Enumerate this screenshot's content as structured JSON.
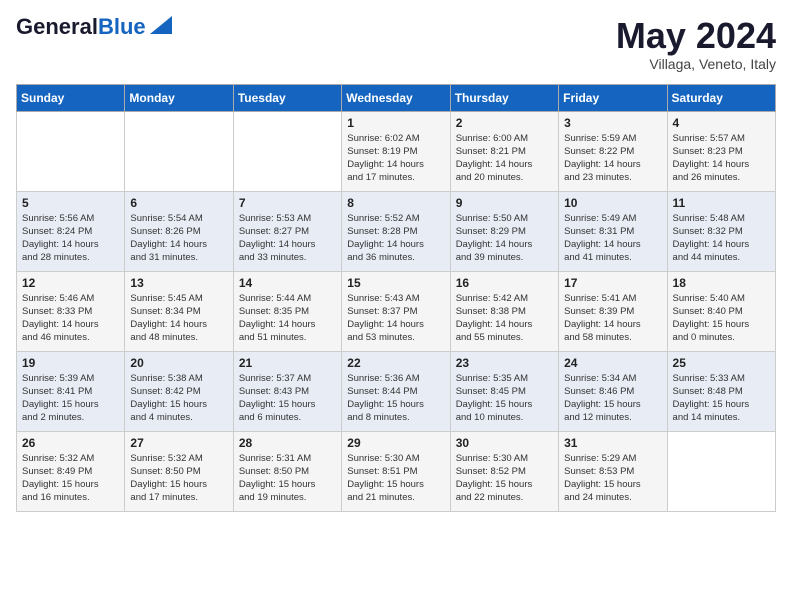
{
  "header": {
    "logo_line1": "General",
    "logo_line2": "Blue",
    "month": "May 2024",
    "location": "Villaga, Veneto, Italy"
  },
  "days_of_week": [
    "Sunday",
    "Monday",
    "Tuesday",
    "Wednesday",
    "Thursday",
    "Friday",
    "Saturday"
  ],
  "weeks": [
    [
      {
        "day": "",
        "content": ""
      },
      {
        "day": "",
        "content": ""
      },
      {
        "day": "",
        "content": ""
      },
      {
        "day": "1",
        "content": "Sunrise: 6:02 AM\nSunset: 8:19 PM\nDaylight: 14 hours\nand 17 minutes."
      },
      {
        "day": "2",
        "content": "Sunrise: 6:00 AM\nSunset: 8:21 PM\nDaylight: 14 hours\nand 20 minutes."
      },
      {
        "day": "3",
        "content": "Sunrise: 5:59 AM\nSunset: 8:22 PM\nDaylight: 14 hours\nand 23 minutes."
      },
      {
        "day": "4",
        "content": "Sunrise: 5:57 AM\nSunset: 8:23 PM\nDaylight: 14 hours\nand 26 minutes."
      }
    ],
    [
      {
        "day": "5",
        "content": "Sunrise: 5:56 AM\nSunset: 8:24 PM\nDaylight: 14 hours\nand 28 minutes."
      },
      {
        "day": "6",
        "content": "Sunrise: 5:54 AM\nSunset: 8:26 PM\nDaylight: 14 hours\nand 31 minutes."
      },
      {
        "day": "7",
        "content": "Sunrise: 5:53 AM\nSunset: 8:27 PM\nDaylight: 14 hours\nand 33 minutes."
      },
      {
        "day": "8",
        "content": "Sunrise: 5:52 AM\nSunset: 8:28 PM\nDaylight: 14 hours\nand 36 minutes."
      },
      {
        "day": "9",
        "content": "Sunrise: 5:50 AM\nSunset: 8:29 PM\nDaylight: 14 hours\nand 39 minutes."
      },
      {
        "day": "10",
        "content": "Sunrise: 5:49 AM\nSunset: 8:31 PM\nDaylight: 14 hours\nand 41 minutes."
      },
      {
        "day": "11",
        "content": "Sunrise: 5:48 AM\nSunset: 8:32 PM\nDaylight: 14 hours\nand 44 minutes."
      }
    ],
    [
      {
        "day": "12",
        "content": "Sunrise: 5:46 AM\nSunset: 8:33 PM\nDaylight: 14 hours\nand 46 minutes."
      },
      {
        "day": "13",
        "content": "Sunrise: 5:45 AM\nSunset: 8:34 PM\nDaylight: 14 hours\nand 48 minutes."
      },
      {
        "day": "14",
        "content": "Sunrise: 5:44 AM\nSunset: 8:35 PM\nDaylight: 14 hours\nand 51 minutes."
      },
      {
        "day": "15",
        "content": "Sunrise: 5:43 AM\nSunset: 8:37 PM\nDaylight: 14 hours\nand 53 minutes."
      },
      {
        "day": "16",
        "content": "Sunrise: 5:42 AM\nSunset: 8:38 PM\nDaylight: 14 hours\nand 55 minutes."
      },
      {
        "day": "17",
        "content": "Sunrise: 5:41 AM\nSunset: 8:39 PM\nDaylight: 14 hours\nand 58 minutes."
      },
      {
        "day": "18",
        "content": "Sunrise: 5:40 AM\nSunset: 8:40 PM\nDaylight: 15 hours\nand 0 minutes."
      }
    ],
    [
      {
        "day": "19",
        "content": "Sunrise: 5:39 AM\nSunset: 8:41 PM\nDaylight: 15 hours\nand 2 minutes."
      },
      {
        "day": "20",
        "content": "Sunrise: 5:38 AM\nSunset: 8:42 PM\nDaylight: 15 hours\nand 4 minutes."
      },
      {
        "day": "21",
        "content": "Sunrise: 5:37 AM\nSunset: 8:43 PM\nDaylight: 15 hours\nand 6 minutes."
      },
      {
        "day": "22",
        "content": "Sunrise: 5:36 AM\nSunset: 8:44 PM\nDaylight: 15 hours\nand 8 minutes."
      },
      {
        "day": "23",
        "content": "Sunrise: 5:35 AM\nSunset: 8:45 PM\nDaylight: 15 hours\nand 10 minutes."
      },
      {
        "day": "24",
        "content": "Sunrise: 5:34 AM\nSunset: 8:46 PM\nDaylight: 15 hours\nand 12 minutes."
      },
      {
        "day": "25",
        "content": "Sunrise: 5:33 AM\nSunset: 8:48 PM\nDaylight: 15 hours\nand 14 minutes."
      }
    ],
    [
      {
        "day": "26",
        "content": "Sunrise: 5:32 AM\nSunset: 8:49 PM\nDaylight: 15 hours\nand 16 minutes."
      },
      {
        "day": "27",
        "content": "Sunrise: 5:32 AM\nSunset: 8:50 PM\nDaylight: 15 hours\nand 17 minutes."
      },
      {
        "day": "28",
        "content": "Sunrise: 5:31 AM\nSunset: 8:50 PM\nDaylight: 15 hours\nand 19 minutes."
      },
      {
        "day": "29",
        "content": "Sunrise: 5:30 AM\nSunset: 8:51 PM\nDaylight: 15 hours\nand 21 minutes."
      },
      {
        "day": "30",
        "content": "Sunrise: 5:30 AM\nSunset: 8:52 PM\nDaylight: 15 hours\nand 22 minutes."
      },
      {
        "day": "31",
        "content": "Sunrise: 5:29 AM\nSunset: 8:53 PM\nDaylight: 15 hours\nand 24 minutes."
      },
      {
        "day": "",
        "content": ""
      }
    ]
  ]
}
